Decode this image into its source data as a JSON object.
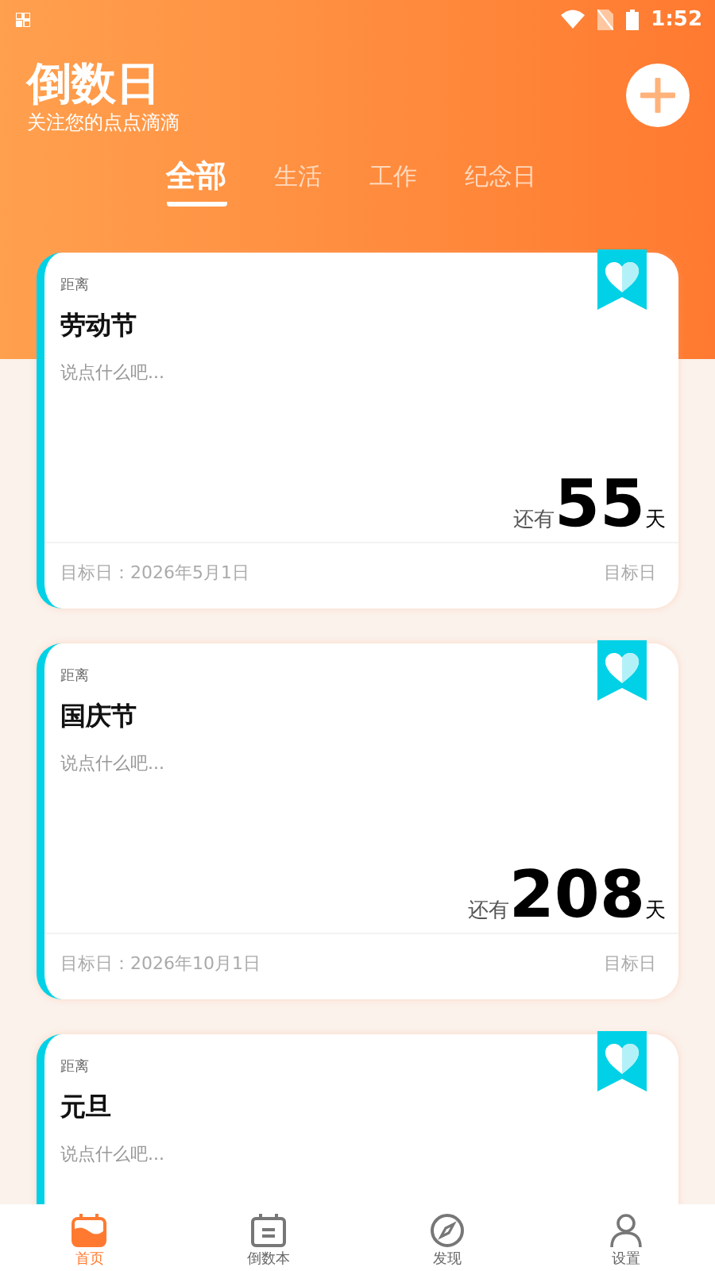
{
  "status_bar": {
    "time": "1:52"
  },
  "header": {
    "title": "倒数日",
    "subtitle": "关注您的点点滴滴"
  },
  "tabs": [
    {
      "label": "全部",
      "selected": true
    },
    {
      "label": "生活",
      "selected": false
    },
    {
      "label": "工作",
      "selected": false
    },
    {
      "label": "纪念日",
      "selected": false
    }
  ],
  "events": [
    {
      "label": "距离",
      "title": "劳动节",
      "note": "说点什么吧...",
      "prefix": "还有",
      "days": "55",
      "unit": "天",
      "target_date": "目标日：2026年5月1日",
      "footer_right": "目标日"
    },
    {
      "label": "距离",
      "title": "国庆节",
      "note": "说点什么吧...",
      "prefix": "还有",
      "days": "208",
      "unit": "天",
      "target_date": "目标日：2026年10月1日",
      "footer_right": "目标日"
    },
    {
      "label": "距离",
      "title": "元旦",
      "note": "说点什么吧..."
    }
  ],
  "bottom_nav": [
    {
      "label": "首页",
      "selected": true
    },
    {
      "label": "倒数本",
      "selected": false
    },
    {
      "label": "发现",
      "selected": false
    },
    {
      "label": "设置",
      "selected": false
    }
  ]
}
